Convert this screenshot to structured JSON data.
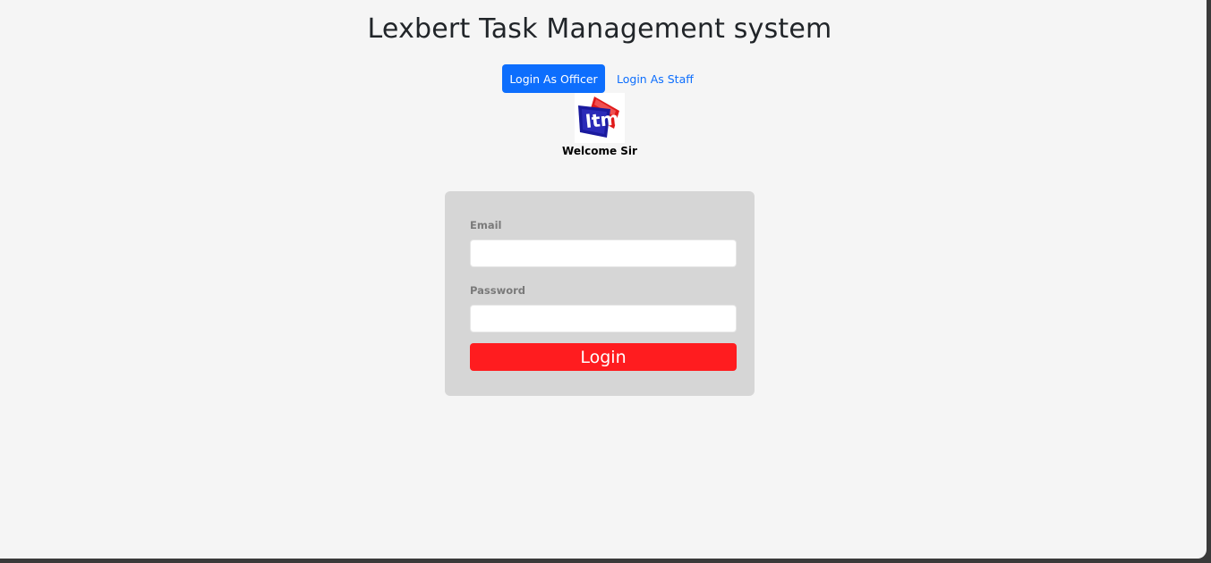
{
  "header": {
    "title": "Lexbert Task Management system"
  },
  "role_tabs": {
    "officer_label": "Login As Officer",
    "staff_label": "Login As Staff"
  },
  "logo": {
    "icon": "ltm-logo-icon",
    "text": "LTM"
  },
  "welcome": {
    "text": "Welcome Sir"
  },
  "login_form": {
    "email_label": "Email",
    "email_value": "",
    "email_placeholder": "",
    "password_label": "Password",
    "password_value": "",
    "password_placeholder": "",
    "submit_label": "Login"
  },
  "colors": {
    "primary": "#0d6efd",
    "login_button": "#ff1c1f",
    "card_background": "#d6d6d6",
    "page_background": "#f5f5f5"
  }
}
